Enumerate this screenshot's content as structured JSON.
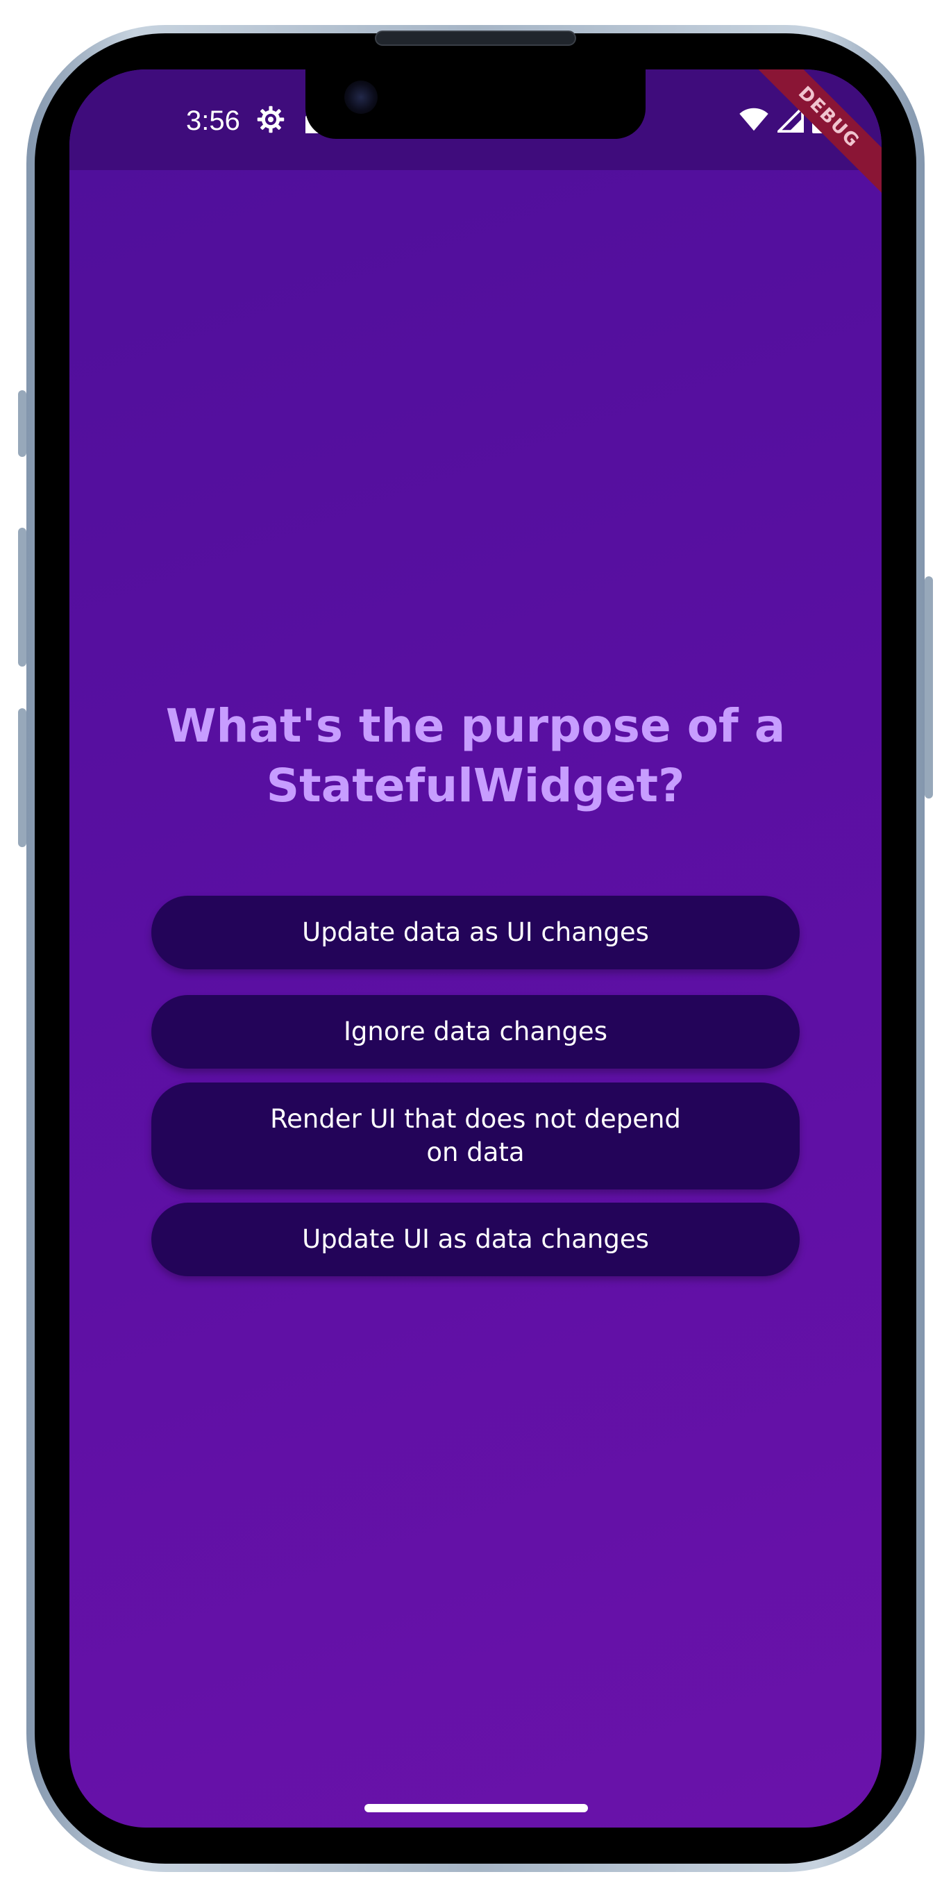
{
  "status_bar": {
    "time": "3:56",
    "icons": [
      "gear-icon",
      "sim-card-icon",
      "wifi-icon",
      "cell-signal-icon",
      "battery-icon"
    ]
  },
  "debug_banner": "DEBUG",
  "quiz": {
    "question": "What's the purpose of a StatefulWidget?",
    "answers": [
      "Update data as UI changes",
      "Ignore data changes",
      "Render UI that does not depend on data",
      "Update UI as data changes"
    ]
  },
  "colors": {
    "background_top": "#4f0f9a",
    "background_bottom": "#6a12aa",
    "status_bar": "#3f0c7c",
    "question_text": "#c79dff",
    "answer_button": "#230459",
    "answer_text": "#ffffff",
    "debug_banner": "#8a1535"
  }
}
